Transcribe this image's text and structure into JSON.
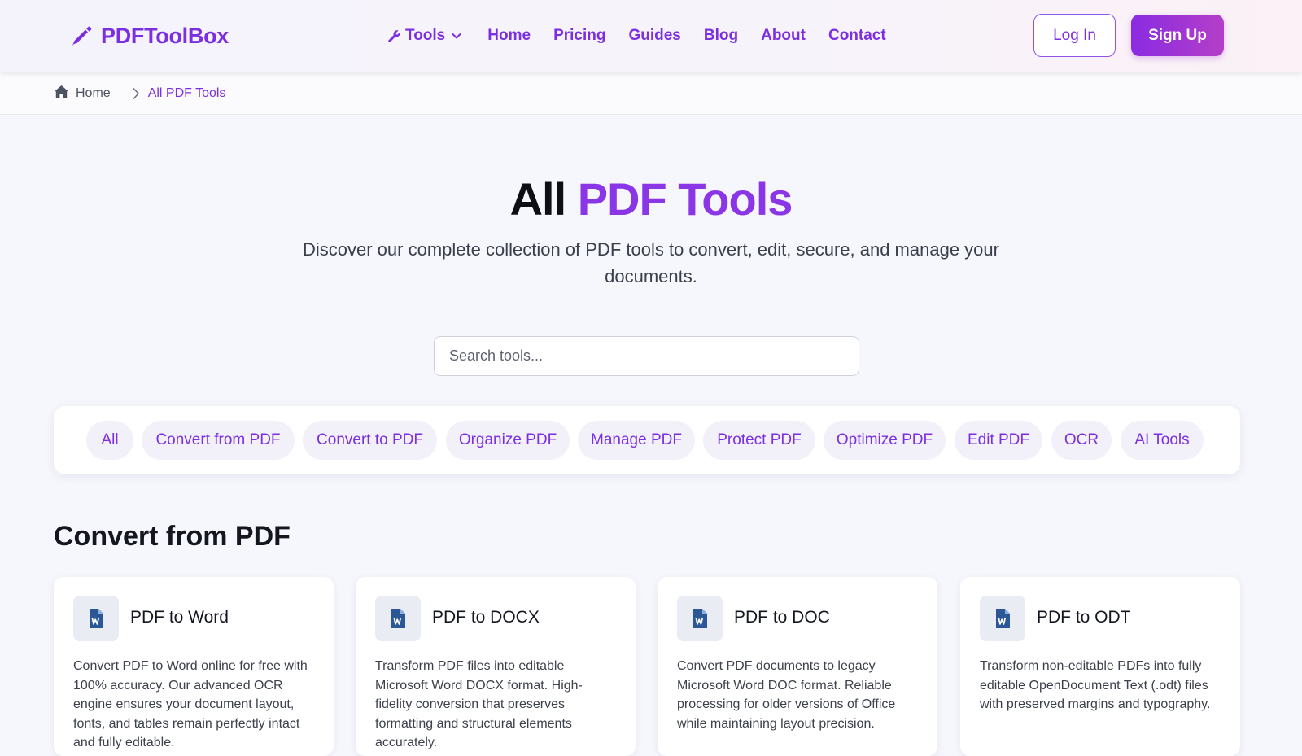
{
  "brand": {
    "name": "PDFToolBox",
    "icon": "pencil-icon"
  },
  "nav": {
    "items": [
      {
        "label": "Tools",
        "icon": "wrench-icon",
        "dropdown": true
      },
      {
        "label": "Home"
      },
      {
        "label": "Pricing"
      },
      {
        "label": "Guides"
      },
      {
        "label": "Blog"
      },
      {
        "label": "About"
      },
      {
        "label": "Contact"
      }
    ]
  },
  "auth": {
    "login_label": "Log In",
    "signup_label": "Sign Up"
  },
  "breadcrumb": {
    "home": "Home",
    "current": "All PDF Tools"
  },
  "hero": {
    "title_plain": "All",
    "title_accent": "PDF Tools",
    "subtitle": "Discover our complete collection of PDF tools to convert, edit, secure, and manage your documents."
  },
  "search": {
    "placeholder": "Search tools...",
    "value": ""
  },
  "filters": [
    "All",
    "Convert from PDF",
    "Convert to PDF",
    "Organize PDF",
    "Manage PDF",
    "Protect PDF",
    "Optimize PDF",
    "Edit PDF",
    "OCR",
    "AI Tools"
  ],
  "section": {
    "title": "Convert from PDF",
    "cards": [
      {
        "title": "PDF to Word",
        "icon": "word-file-icon",
        "description": "Convert PDF to Word online for free with 100% accuracy. Our advanced OCR engine ensures your document layout, fonts, and tables remain perfectly intact and fully editable."
      },
      {
        "title": "PDF to DOCX",
        "icon": "word-file-icon",
        "description": "Transform PDF files into editable Microsoft Word DOCX format. High-fidelity conversion that preserves formatting and structural elements accurately."
      },
      {
        "title": "PDF to DOC",
        "icon": "word-file-icon",
        "description": "Convert PDF documents to legacy Microsoft Word DOC format. Reliable processing for older versions of Office while maintaining layout precision."
      },
      {
        "title": "PDF to ODT",
        "icon": "word-file-icon",
        "description": "Transform non-editable PDFs into fully editable OpenDocument Text (.odt) files with preserved margins and typography."
      }
    ]
  },
  "colors": {
    "accent": "#7b2fe0",
    "signup_gradient_start": "#8a2be2",
    "signup_gradient_end": "#b43ec8",
    "icon_blue": "#2b5797"
  }
}
